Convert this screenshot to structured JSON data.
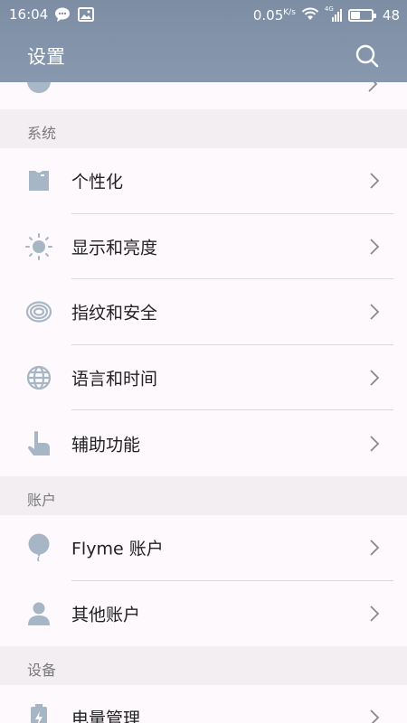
{
  "status_bar": {
    "time": "16:04",
    "speed": "0.05",
    "speed_unit": "K/s",
    "signal_label": "4G",
    "battery": "48",
    "battery_level": 0.48
  },
  "header": {
    "title": "设置"
  },
  "sections": [
    {
      "title": "系统",
      "items": [
        {
          "label": "个性化",
          "icon": "shirt-icon"
        },
        {
          "label": "显示和亮度",
          "icon": "sun-icon"
        },
        {
          "label": "指纹和安全",
          "icon": "fingerprint-icon"
        },
        {
          "label": "语言和时间",
          "icon": "globe-icon"
        },
        {
          "label": "辅助功能",
          "icon": "hand-pointer-icon"
        }
      ]
    },
    {
      "title": "账户",
      "items": [
        {
          "label": "Flyme 账户",
          "icon": "balloon-icon"
        },
        {
          "label": "其他账户",
          "icon": "person-icon"
        }
      ]
    },
    {
      "title": "设备",
      "items": [
        {
          "label": "电量管理",
          "icon": "battery-icon"
        }
      ]
    }
  ],
  "colors": {
    "header": "#8292a9",
    "icon": "#a7b6c4",
    "section_bg": "#f2eef2",
    "row_bg": "#fdf9fc"
  }
}
